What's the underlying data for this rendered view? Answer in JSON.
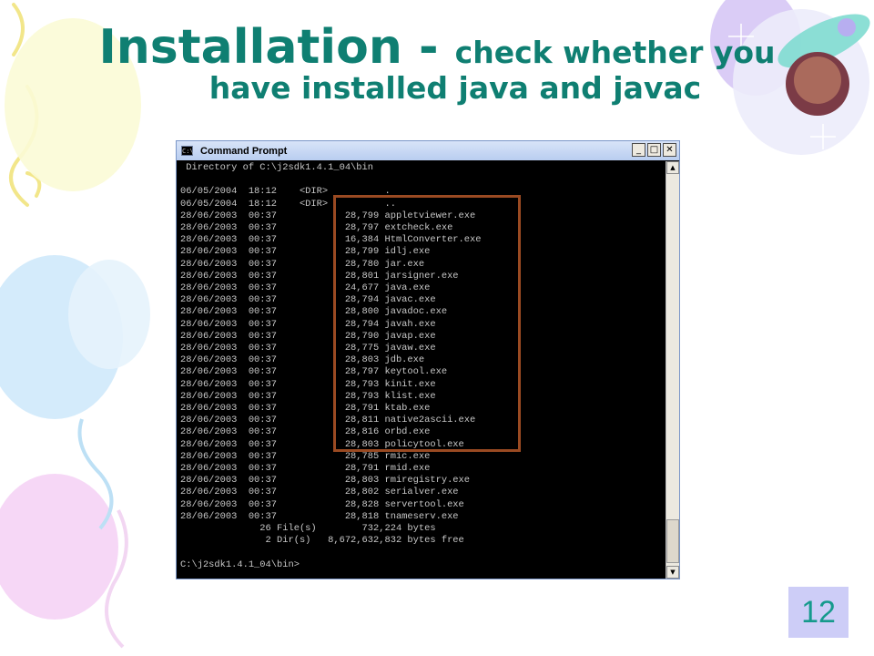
{
  "slide": {
    "title_main": "Installation - ",
    "title_rest": "check whether you",
    "title_line2": "have installed java and javac",
    "slide_number": "12"
  },
  "window": {
    "title": "Command Prompt",
    "icon_label": "C:\\",
    "buttons": {
      "minimize": "_",
      "maximize": "□",
      "close": "✕"
    },
    "scroll_up": "▲",
    "scroll_down": "▼"
  },
  "console": {
    "lines": [
      " Directory of C:\\j2sdk1.4.1_04\\bin",
      "",
      "06/05/2004  18:12    <DIR>          .",
      "06/05/2004  18:12    <DIR>          ..",
      "28/06/2003  00:37            28,799 appletviewer.exe",
      "28/06/2003  00:37            28,797 extcheck.exe",
      "28/06/2003  00:37            16,384 HtmlConverter.exe",
      "28/06/2003  00:37            28,799 idlj.exe",
      "28/06/2003  00:37            28,780 jar.exe",
      "28/06/2003  00:37            28,801 jarsigner.exe",
      "28/06/2003  00:37            24,677 java.exe",
      "28/06/2003  00:37            28,794 javac.exe",
      "28/06/2003  00:37            28,800 javadoc.exe",
      "28/06/2003  00:37            28,794 javah.exe",
      "28/06/2003  00:37            28,790 javap.exe",
      "28/06/2003  00:37            28,775 javaw.exe",
      "28/06/2003  00:37            28,803 jdb.exe",
      "28/06/2003  00:37            28,797 keytool.exe",
      "28/06/2003  00:37            28,793 kinit.exe",
      "28/06/2003  00:37            28,793 klist.exe",
      "28/06/2003  00:37            28,791 ktab.exe",
      "28/06/2003  00:37            28,811 native2ascii.exe",
      "28/06/2003  00:37            28,816 orbd.exe",
      "28/06/2003  00:37            28,803 policytool.exe",
      "28/06/2003  00:37            28,785 rmic.exe",
      "28/06/2003  00:37            28,791 rmid.exe",
      "28/06/2003  00:37            28,803 rmiregistry.exe",
      "28/06/2003  00:37            28,802 serialver.exe",
      "28/06/2003  00:37            28,828 servertool.exe",
      "28/06/2003  00:37            28,818 tnameserv.exe",
      "              26 File(s)        732,224 bytes",
      "               2 Dir(s)   8,672,632,832 bytes free",
      "",
      "C:\\j2sdk1.4.1_04\\bin>"
    ]
  },
  "colors": {
    "title": "#0f7f72",
    "highlight": "#9a4a22",
    "slide_number_bg": "#cdcdf7",
    "slide_number_text": "#159a8c"
  }
}
